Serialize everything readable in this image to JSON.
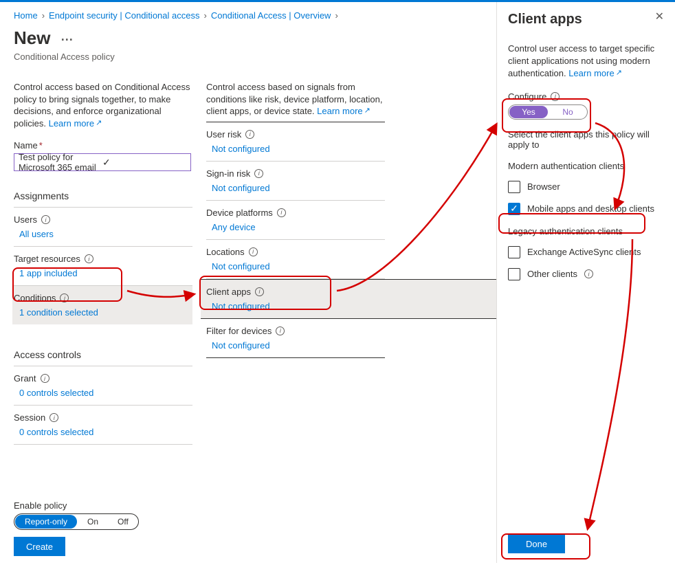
{
  "breadcrumb": {
    "home": "Home",
    "b1": "Endpoint security | Conditional access",
    "b2": "Conditional Access | Overview"
  },
  "header": {
    "title": "New",
    "subtitle": "Conditional Access policy"
  },
  "col1": {
    "desc": "Control access based on Conditional Access policy to bring signals together, to make decisions, and enforce organizational policies.",
    "learn_more": "Learn more",
    "name_label": "Name",
    "name_value": "Test policy for Microsoft 365 email",
    "assignments_head": "Assignments",
    "users_label": "Users",
    "users_link": "All users",
    "resources_label": "Target resources",
    "resources_link": "1 app included",
    "conditions_label": "Conditions",
    "conditions_link": "1 condition selected",
    "access_head": "Access controls",
    "grant_label": "Grant",
    "grant_link": "0 controls selected",
    "session_label": "Session",
    "session_link": "0 controls selected"
  },
  "col2": {
    "desc": "Control access based on signals from conditions like risk, device platform, location, client apps, or device state.",
    "learn_more": "Learn more",
    "rows": [
      {
        "label": "User risk",
        "link": "Not configured"
      },
      {
        "label": "Sign-in risk",
        "link": "Not configured"
      },
      {
        "label": "Device platforms",
        "link": "Any device"
      },
      {
        "label": "Locations",
        "link": "Not configured"
      },
      {
        "label": "Client apps",
        "link": "Not configured"
      },
      {
        "label": "Filter for devices",
        "link": "Not configured"
      }
    ]
  },
  "footer": {
    "enable_label": "Enable policy",
    "opt1": "Report-only",
    "opt2": "On",
    "opt3": "Off",
    "create": "Create"
  },
  "panel": {
    "title": "Client apps",
    "desc": "Control user access to target specific client applications not using modern authentication.",
    "learn_more": "Learn more",
    "configure_label": "Configure",
    "yes": "Yes",
    "no": "No",
    "select_text": "Select the client apps this policy will apply to",
    "group1": "Modern authentication clients",
    "chk1": "Browser",
    "chk2": "Mobile apps and desktop clients",
    "group2": "Legacy authentication clients",
    "chk3": "Exchange ActiveSync clients",
    "chk4": "Other clients",
    "done": "Done"
  }
}
